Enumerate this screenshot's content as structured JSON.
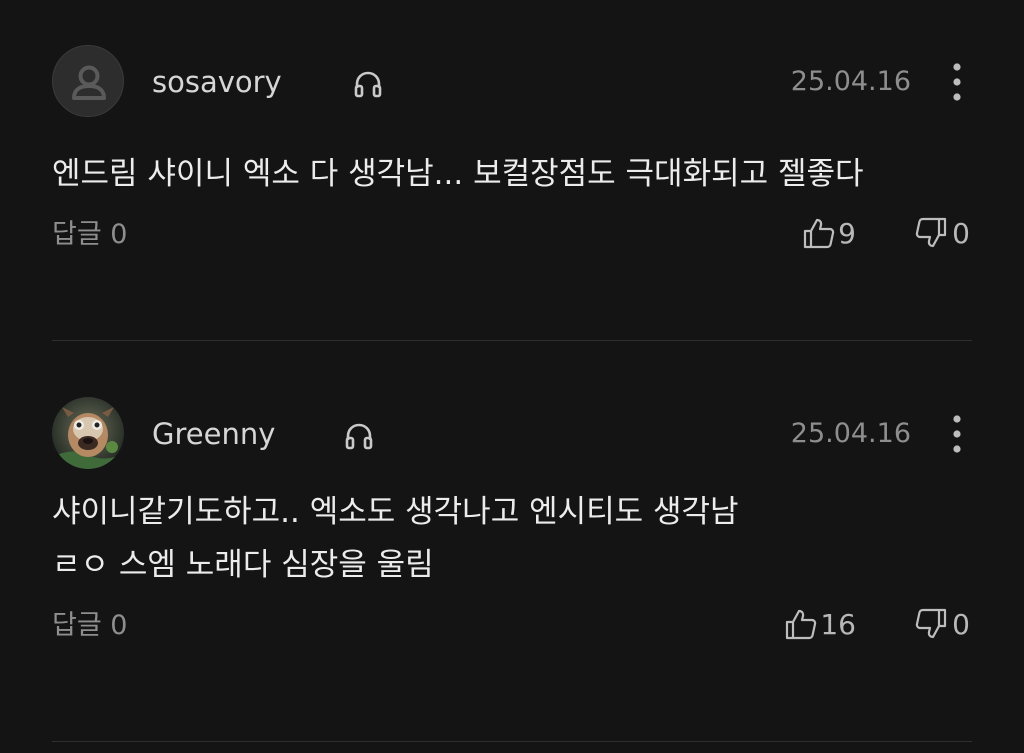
{
  "comments": [
    {
      "username": "sosavory",
      "avatar_icon": "default-user-icon",
      "date": "25.04.16",
      "lines": [
        "엔드림 샤이니 엑소 다 생각남... 보컬장점도 극대화되고 젤좋다"
      ],
      "reply_label": "답글 0",
      "likes": "9",
      "dislikes": "0"
    },
    {
      "username": "Greenny",
      "avatar_icon": "photo-avatar",
      "date": "25.04.16",
      "lines": [
        "샤이니같기도하고.. 엑소도 생각나고 엔시티도 생각남",
        "ㄹㅇ 스엠 노래다 심장을 울림"
      ],
      "reply_label": "답글 0",
      "likes": "16",
      "dislikes": "0"
    }
  ],
  "colors": {
    "background": "#141414",
    "text": "#ececec",
    "muted": "#8e8e8e",
    "divider": "#2e2e2e"
  }
}
